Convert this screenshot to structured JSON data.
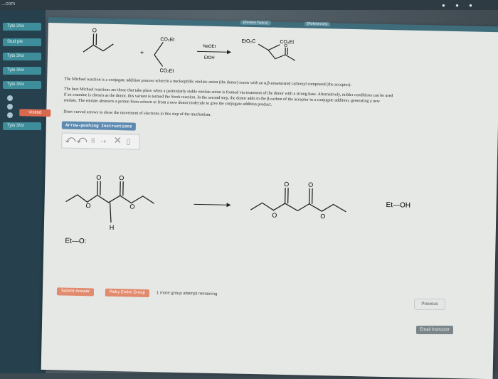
{
  "browser": {
    "url_fragment": "...com"
  },
  "nav": {
    "items": [
      {
        "label": "Tyto  2/xx"
      },
      {
        "label": "Stud ple"
      },
      {
        "label": "Tyto 3/xx"
      },
      {
        "label": "Tyto 3/xx"
      },
      {
        "label": "Tyto 3/xx"
      },
      {
        "label": "Tyto 3/xx"
      }
    ]
  },
  "header": {
    "review_topics": "[Review Topics]",
    "references": "[References]"
  },
  "reaction": {
    "co2et_top": "CO₂Et",
    "co2et_bottom": "CO₂Et",
    "reagent_base": "NaOEt",
    "reagent_solvent": "EtOH",
    "product_left": "EtO₂C",
    "product_right": "CO₂Et"
  },
  "text": {
    "intro": "The Michael reaction is a conjugate addition process wherein a nucleophilic enolate anion (the donor) reacts with an α,β-unsaturated carbonyl compound (the acceptor).",
    "detail_1": "The best Michael reactions are those that take place when a particularly stable enolate anion is formed via treatment of the donor with a strong base. Alternatively, milder conditions can be used",
    "detail_2": "if an enamine is chosen as the donor, this variant is termed the Stork reaction. In the second step, the donor adds to the β-carbon of the acceptor in a conjugate addition, generating a new",
    "detail_3": "enolate. The enolate abstracts a proton from solvent or from a new donor molecule to give the conjugate addition product.",
    "instruction": "Draw curved arrows to show the movement of electrons in this step of the mechanism."
  },
  "side_tag": "Visited",
  "arrow_instructions": "Arrow-pushing Instructions",
  "mechanism": {
    "atom_o": "O",
    "atom_h": "H",
    "ethoxide": "Et—O:",
    "ethanol": "Et—OH"
  },
  "actions": {
    "submit": "Submit Answer",
    "retry": "Retry Entire Group",
    "remaining": "1 more group attempt remaining",
    "previous": "Previous",
    "email": "Email Instructor"
  }
}
